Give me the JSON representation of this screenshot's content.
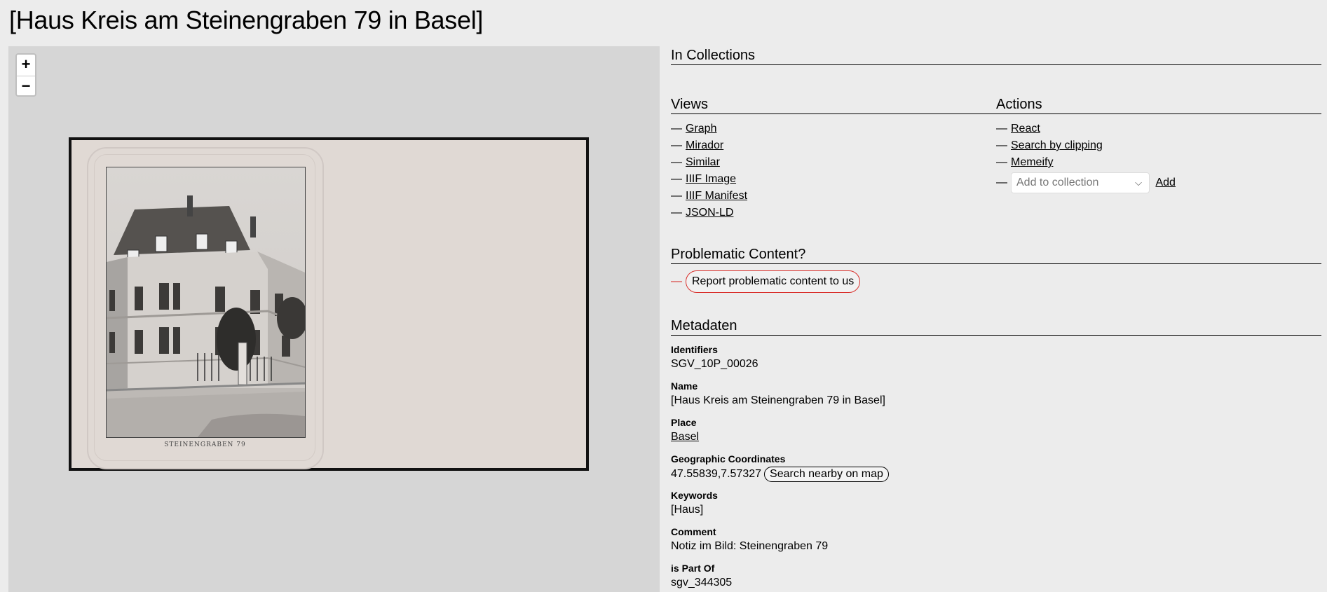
{
  "page": {
    "title": "[Haus Kreis am Steinengraben 79 in Basel]"
  },
  "viewer": {
    "zoom_in": "+",
    "zoom_out": "−",
    "image_caption": "STEINENGRABEN 79"
  },
  "collections": {
    "heading": "In Collections"
  },
  "views": {
    "heading": "Views",
    "items": [
      {
        "label": "Graph"
      },
      {
        "label": "Mirador"
      },
      {
        "label": "Similar"
      },
      {
        "label": "IIIF Image"
      },
      {
        "label": "IIIF Manifest"
      },
      {
        "label": "JSON-LD"
      }
    ]
  },
  "actions": {
    "heading": "Actions",
    "items": [
      {
        "label": "React"
      },
      {
        "label": "Search by clipping"
      },
      {
        "label": "Memeify"
      }
    ],
    "collection_select_placeholder": "Add to collection",
    "add_label": "Add"
  },
  "problematic": {
    "heading": "Problematic Content?",
    "button_label": "Report problematic content to us",
    "accent_color": "#d9302c"
  },
  "metadata": {
    "heading": "Metadaten",
    "identifiers_label": "Identifiers",
    "identifiers_value": "SGV_10P_00026",
    "name_label": "Name",
    "name_value": "[Haus Kreis am Steinengraben 79 in Basel]",
    "place_label": "Place",
    "place_value": "Basel",
    "coords_label": "Geographic Coordinates",
    "coords_value": "47.55839,7.57327",
    "coords_button": "Search nearby on map",
    "keywords_label": "Keywords",
    "keywords_value": "[Haus]",
    "comment_label": "Comment",
    "comment_value": "Notiz im Bild: Steinengraben 79",
    "part_of_label": "is Part Of",
    "part_of_value": "sgv_344305"
  },
  "icons": [
    "chevron-down-icon",
    "zoom-in-icon",
    "zoom-out-icon"
  ]
}
